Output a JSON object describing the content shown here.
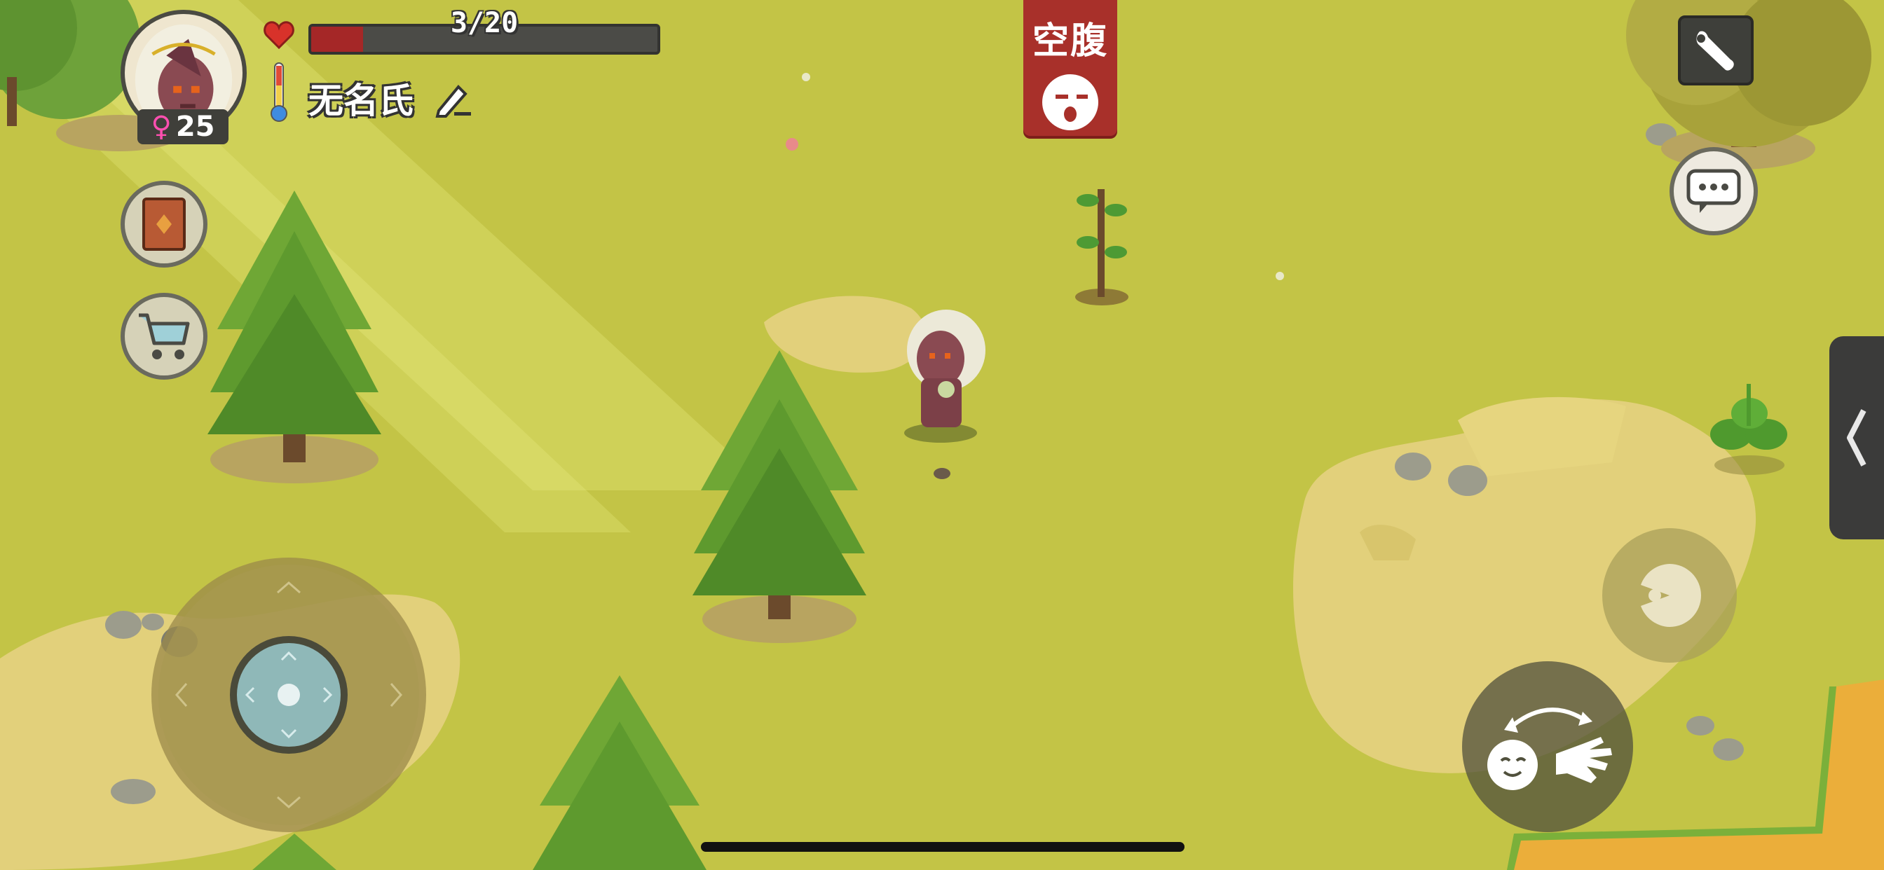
{
  "hud": {
    "health_text": "3/20",
    "health_fraction": 0.15,
    "player_name": "无名氏",
    "age": "25",
    "gender_symbol": "♀"
  },
  "status": {
    "hunger_label": "空腹"
  },
  "icons": {
    "heart": "heart-icon",
    "thermometer": "thermometer-icon",
    "edit": "pencil-icon",
    "book": "book-icon",
    "shop": "shopping-cart-icon",
    "settings": "wrench-icon",
    "chat": "chat-bubble-icon",
    "eat": "eat-icon",
    "swap": "swap-hand-icon",
    "expand": "chevron-left-icon"
  },
  "colors": {
    "grass": "#c3c446",
    "dirt": "#e2d07b",
    "health_fill": "#a52727",
    "hunger_banner": "#a8302a",
    "ui_dark": "#3e3f3a"
  }
}
